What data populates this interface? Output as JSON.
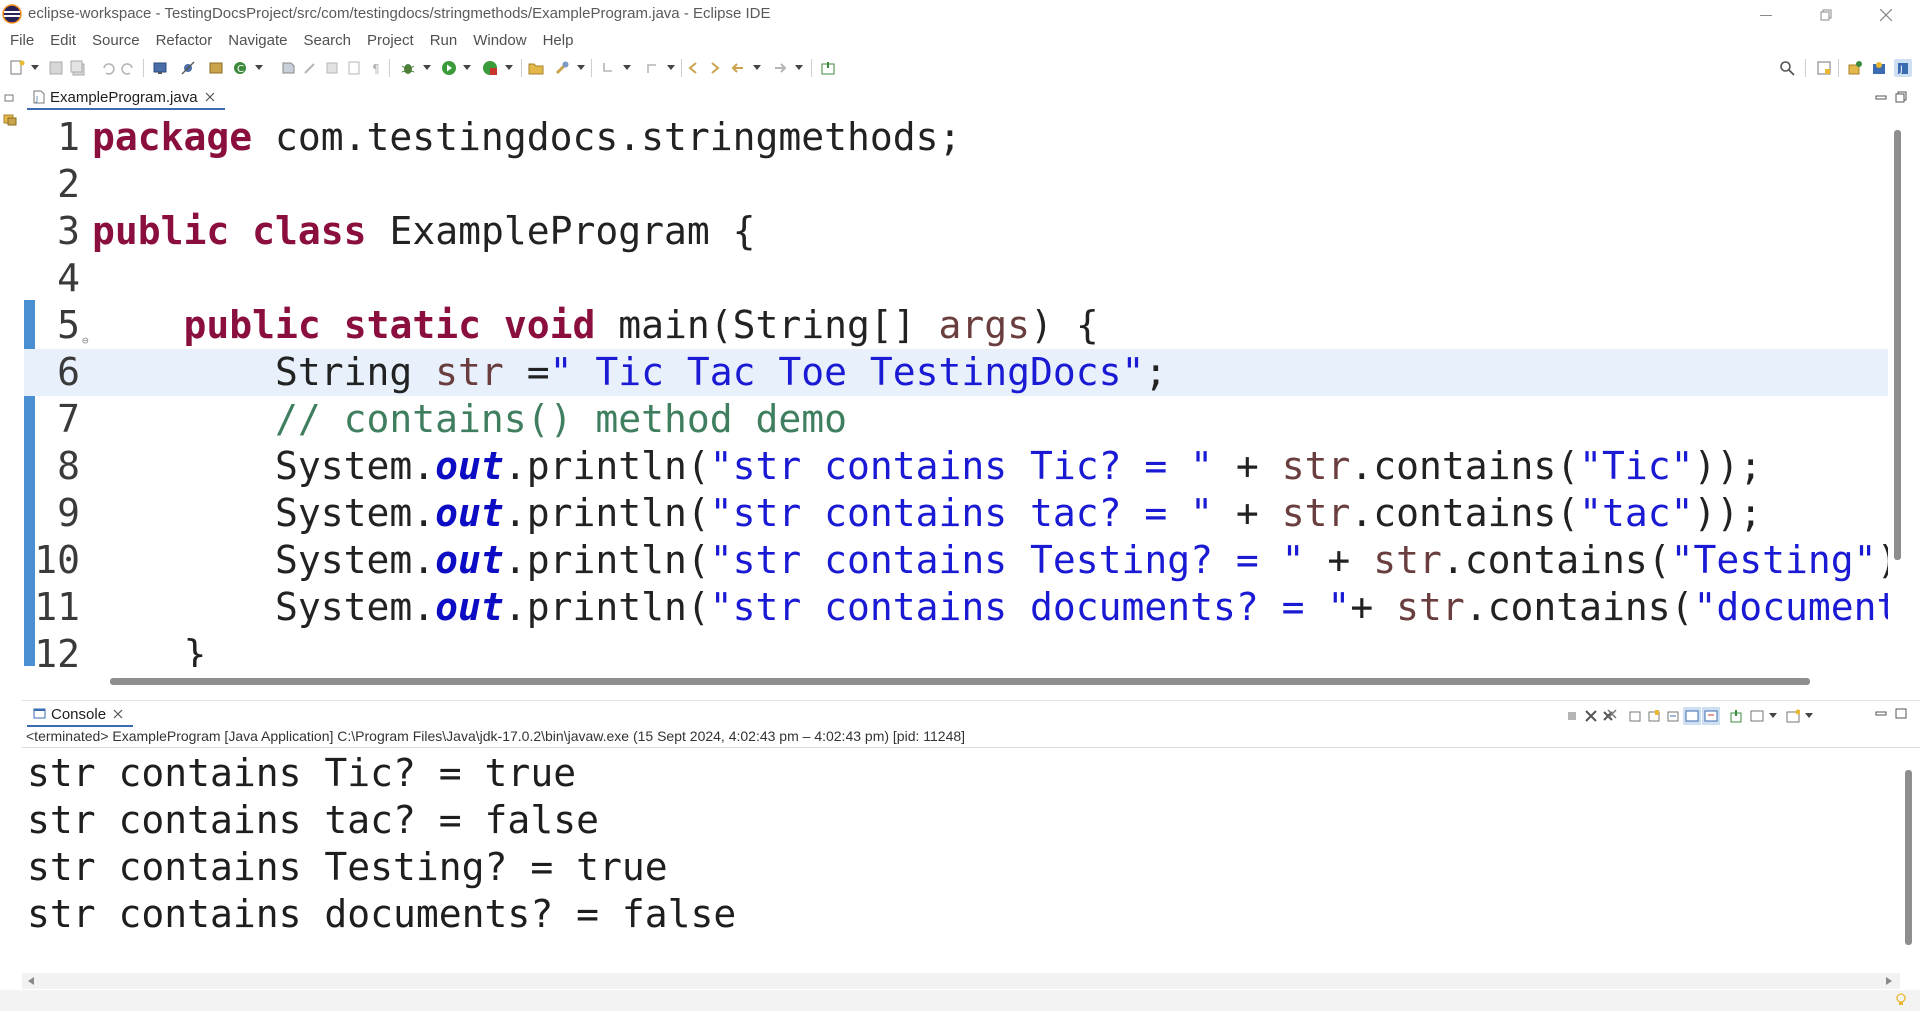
{
  "window": {
    "title": "eclipse-workspace - TestingDocsProject/src/com/testingdocs/stringmethods/ExampleProgram.java - Eclipse IDE"
  },
  "menu": [
    "File",
    "Edit",
    "Source",
    "Refactor",
    "Navigate",
    "Search",
    "Project",
    "Run",
    "Window",
    "Help"
  ],
  "editor": {
    "tab_label": "ExampleProgram.java",
    "active_line": 6,
    "lines": [
      {
        "n": "1"
      },
      {
        "n": "2"
      },
      {
        "n": "3"
      },
      {
        "n": "4"
      },
      {
        "n": "5"
      },
      {
        "n": "6"
      },
      {
        "n": "7"
      },
      {
        "n": "8"
      },
      {
        "n": "9"
      },
      {
        "n": "10"
      },
      {
        "n": "11"
      },
      {
        "n": "12"
      }
    ]
  },
  "console": {
    "tab_label": "Console",
    "status": "<terminated> ExampleProgram [Java Application] C:\\Program Files\\Java\\jdk-17.0.2\\bin\\javaw.exe  (15 Sept 2024, 4:02:43 pm – 4:02:43 pm) [pid: 11248]",
    "output": [
      "str contains Tic? = true",
      "str contains tac? = false",
      "str contains Testing? = true",
      "str contains documents? = false"
    ]
  },
  "colors": {
    "keyword": "#8a0f3e",
    "string": "#1a1ad4",
    "comment": "#3f7f5f",
    "static_field": "#0c0cc4",
    "local_variable": "#6a3e3e",
    "active_line_bg": "#e8f0fb",
    "tab_accent": "#3d6bb0"
  },
  "icons": [
    "eclipse-app-icon",
    "minimize-icon",
    "maximize-icon",
    "close-icon",
    "search-icon",
    "java-file-icon",
    "console-icon",
    "fold-collapse-icon"
  ]
}
